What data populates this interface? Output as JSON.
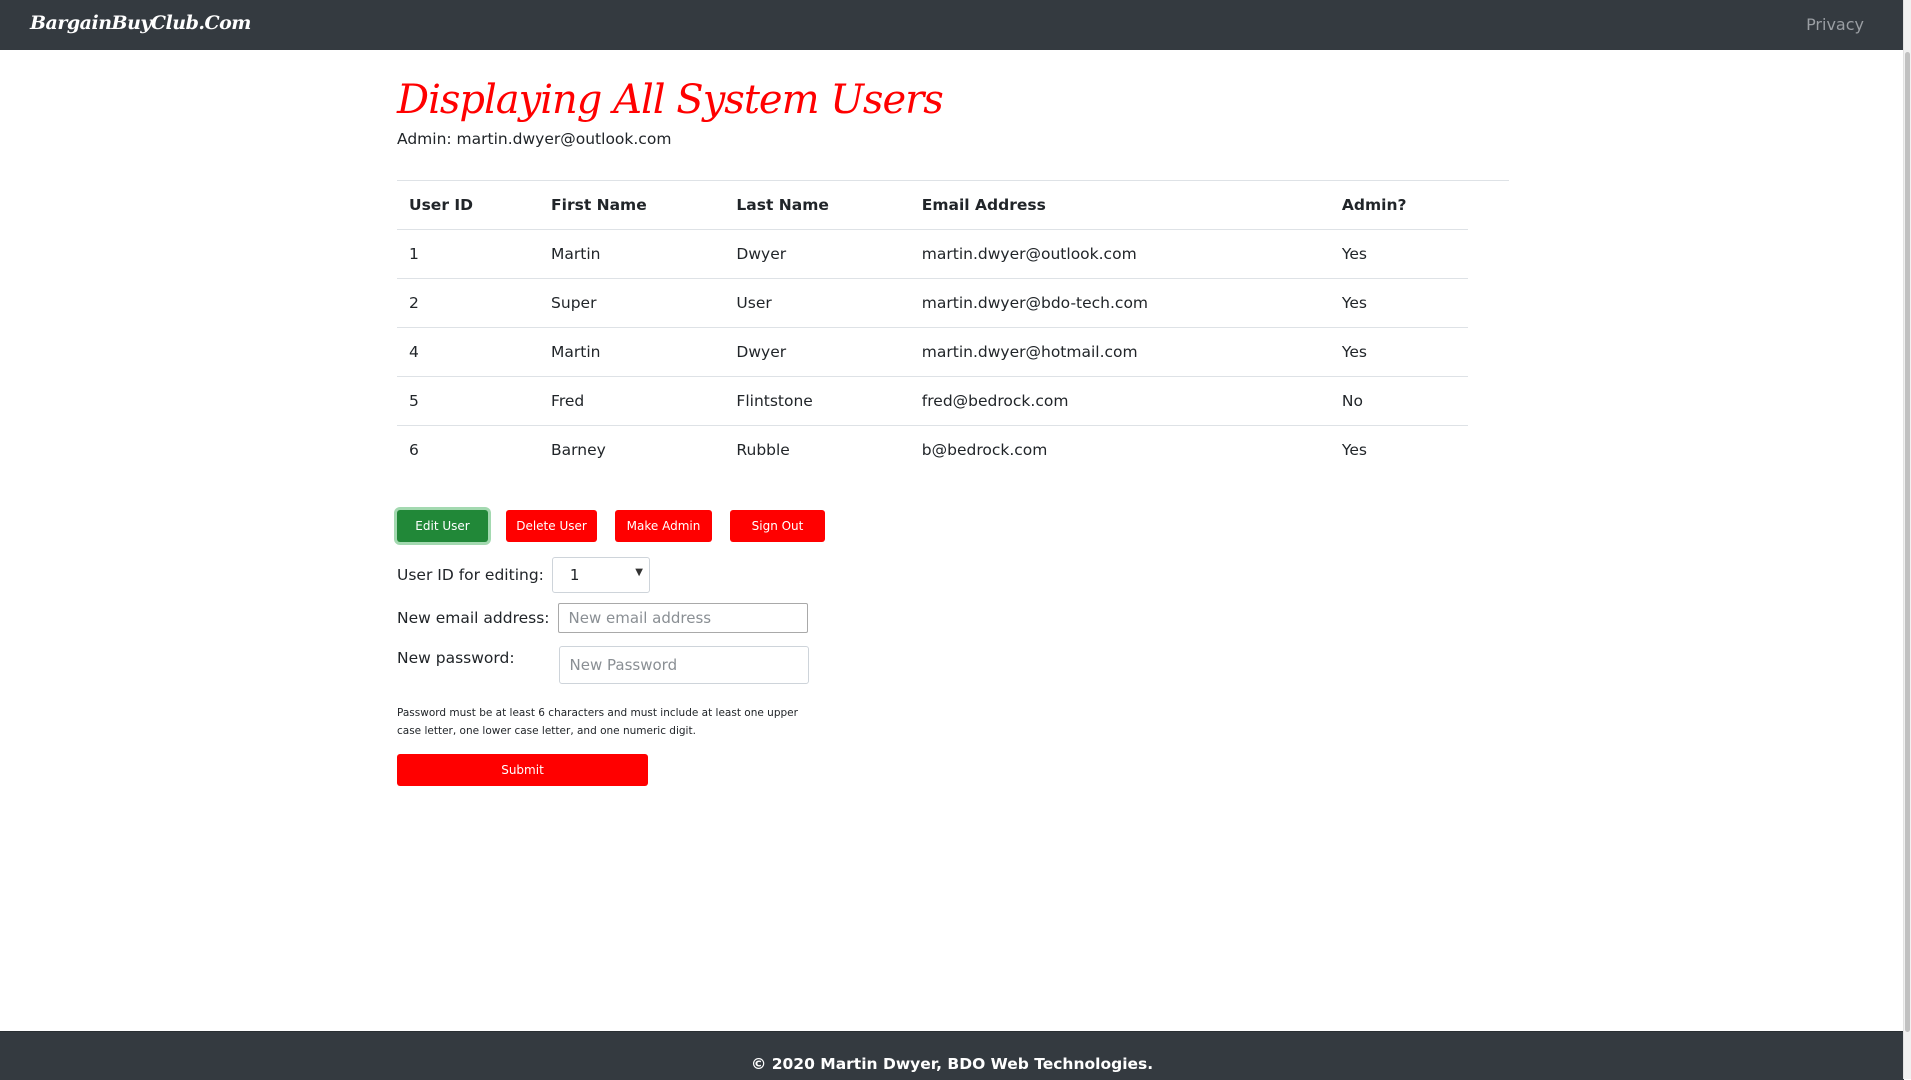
{
  "navbar": {
    "brand": "BargainBuyClub.Com",
    "privacy_link": "Privacy"
  },
  "header": {
    "title": "Displaying All System Users",
    "admin_label": "Admin: martin.dwyer@outlook.com"
  },
  "table": {
    "columns": [
      "User ID",
      "First Name",
      "Last Name",
      "Email Address",
      "Admin?"
    ],
    "rows": [
      [
        "1",
        "Martin",
        "Dwyer",
        "martin.dwyer@outlook.com",
        "Yes"
      ],
      [
        "2",
        "Super",
        "User",
        "martin.dwyer@bdo-tech.com",
        "Yes"
      ],
      [
        "4",
        "Martin",
        "Dwyer",
        "martin.dwyer@hotmail.com",
        "Yes"
      ],
      [
        "5",
        "Fred",
        "Flintstone",
        "fred@bedrock.com",
        "No"
      ],
      [
        "6",
        "Barney",
        "Rubble",
        "b@bedrock.com",
        "Yes"
      ]
    ]
  },
  "actions": {
    "edit_user": "Edit User",
    "delete_user": "Delete User",
    "make_admin": "Make Admin",
    "sign_out": "Sign Out"
  },
  "form": {
    "user_id_label": "User ID for editing:",
    "user_id_value": "1",
    "email_label": "New email address:",
    "email_placeholder": "New email address",
    "password_label": "New password:",
    "password_placeholder": "New Password",
    "help_text": "Password must be at least 6 characters and must include at least one upper case letter, one lower case letter, and one numeric digit.",
    "submit": "Submit"
  },
  "footer": {
    "text": "© 2020 Martin Dwyer, BDO Web Technologies."
  },
  "colors": {
    "navbar": "#343a40",
    "accent_red": "#ff0000",
    "edit_green": "#218838"
  }
}
